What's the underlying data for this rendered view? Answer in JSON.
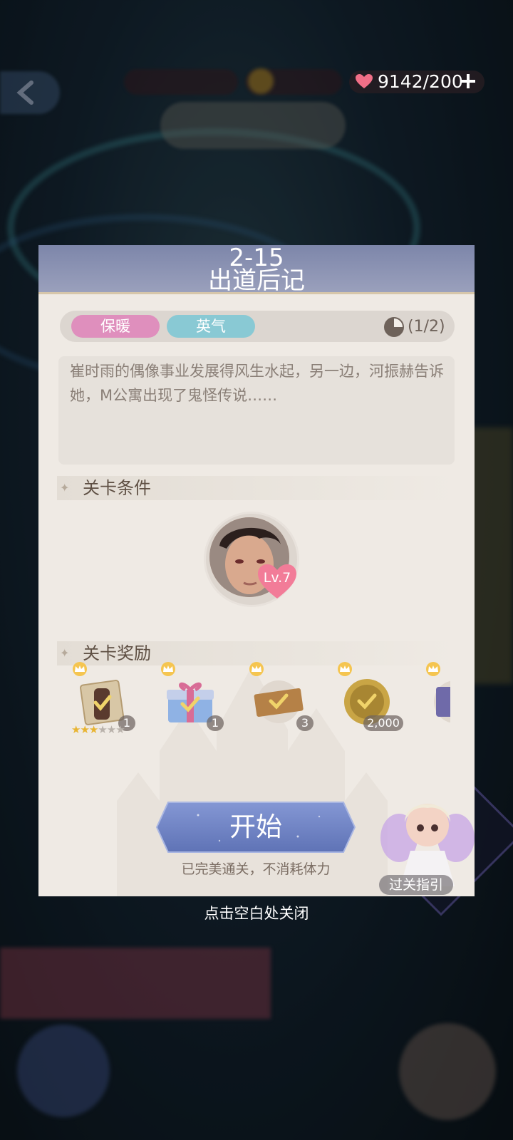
{
  "top_bar": {
    "energy_text": "9142/200"
  },
  "panel": {
    "level_number": "2-15",
    "level_name": "出道后记",
    "tags": [
      "保暖",
      "英气"
    ],
    "progress_text": "(1/2)",
    "description": "崔时雨的偶像事业发展得风生水起，另一边，河振赫告诉她，M公寓出现了鬼怪传说……",
    "conditions_title": "关卡条件",
    "condition_level": "Lv.7",
    "rewards_title": "关卡奖励",
    "rewards": [
      {
        "name": "bottle",
        "count": "1",
        "stars": 3,
        "max_stars": 6
      },
      {
        "name": "gift-box",
        "count": "1"
      },
      {
        "name": "ticket",
        "count": "3"
      },
      {
        "name": "gold-coin",
        "count": "2,000"
      },
      {
        "name": "purple-item",
        "count": ""
      }
    ],
    "start_label": "开始",
    "start_sub": "已完美通关，不消耗体力",
    "guide_label": "过关指引"
  },
  "close_hint": "点击空白处关闭",
  "colors": {
    "header": "#8a91b0",
    "panel_bg": "#efeae4",
    "tag_pink": "#df8fbd",
    "tag_blue": "#89c9d4",
    "start_button": "#7387c8"
  }
}
